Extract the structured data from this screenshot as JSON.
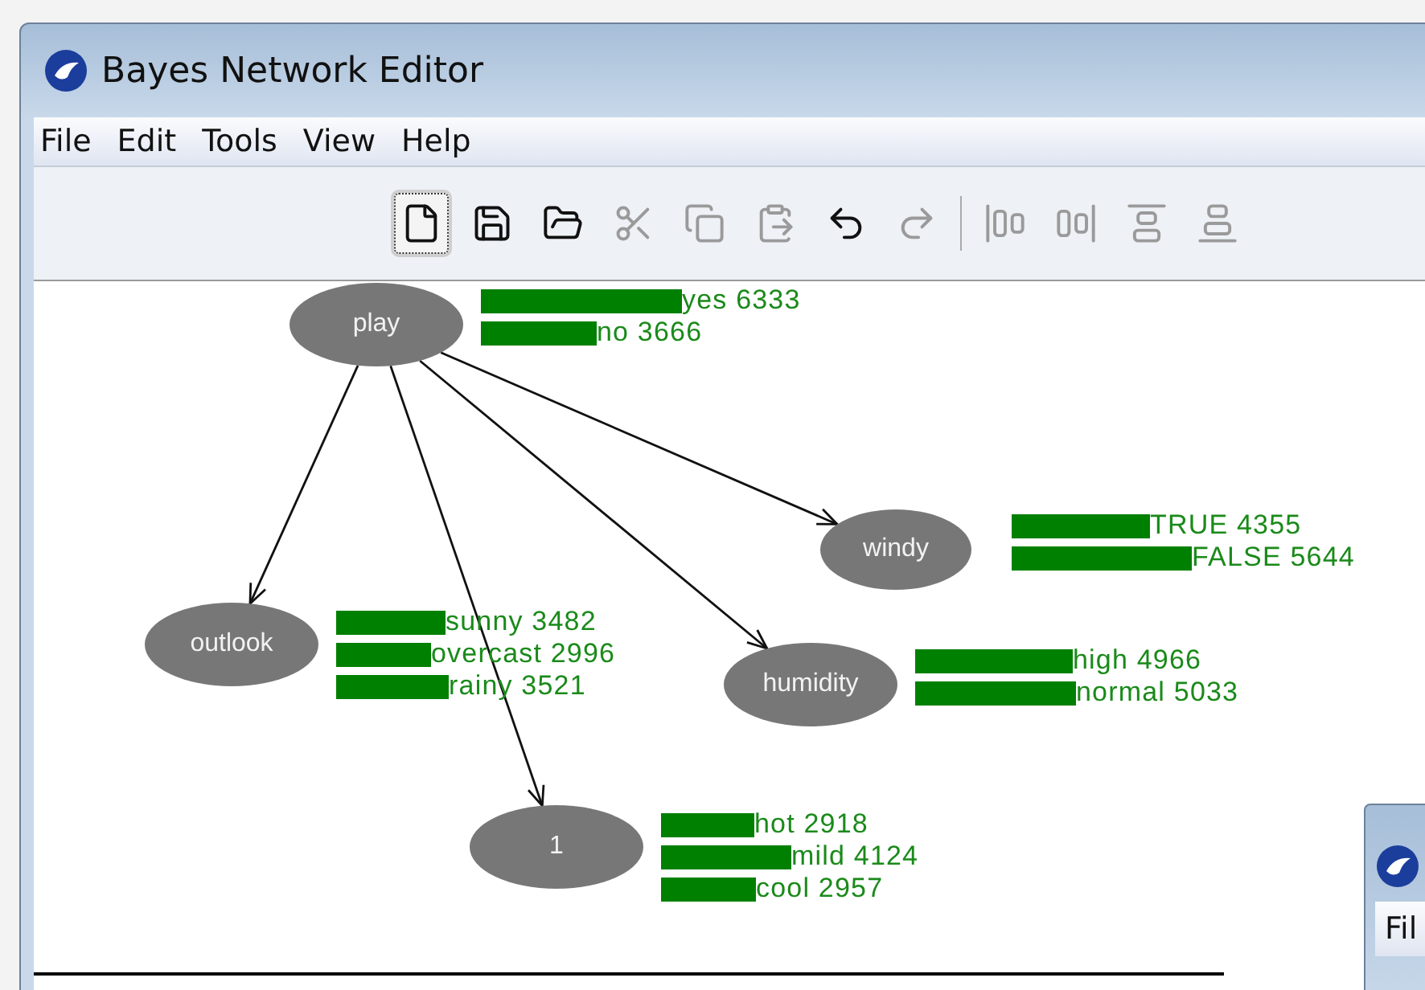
{
  "window": {
    "title": "Bayes Network Editor"
  },
  "menu": [
    "File",
    "Edit",
    "Tools",
    "View",
    "Help"
  ],
  "toolbar": [
    {
      "kind": "new",
      "disabled": false,
      "selected": true
    },
    {
      "kind": "save",
      "disabled": false,
      "selected": false
    },
    {
      "kind": "open",
      "disabled": false,
      "selected": false
    },
    {
      "kind": "cut",
      "disabled": true,
      "selected": false
    },
    {
      "kind": "copy",
      "disabled": true,
      "selected": false
    },
    {
      "kind": "paste",
      "disabled": true,
      "selected": false
    },
    {
      "kind": "undo",
      "disabled": false,
      "selected": false
    },
    {
      "kind": "redo",
      "disabled": true,
      "selected": false
    },
    {
      "kind": "separator"
    },
    {
      "kind": "align-left",
      "disabled": true,
      "selected": false
    },
    {
      "kind": "align-right",
      "disabled": true,
      "selected": false
    },
    {
      "kind": "align-top",
      "disabled": true,
      "selected": false
    },
    {
      "kind": "align-bottom",
      "disabled": true,
      "selected": false
    }
  ],
  "network": {
    "nodes": [
      {
        "name": "play",
        "states": [
          {
            "label": "yes 6333"
          },
          {
            "label": "no 3666"
          }
        ]
      },
      {
        "name": "windy",
        "states": [
          {
            "label": "TRUE 4355"
          },
          {
            "label": "FALSE 5644"
          }
        ]
      },
      {
        "name": "outlook",
        "states": [
          {
            "label": "sunny 3482"
          },
          {
            "label": "overcast 2996"
          },
          {
            "label": "rainy 3521"
          }
        ]
      },
      {
        "name": "humidity",
        "states": [
          {
            "label": "high 4966"
          },
          {
            "label": "normal 5033"
          }
        ]
      },
      {
        "name": "1",
        "states": [
          {
            "label": "hot 2918"
          },
          {
            "label": "mild 4124"
          },
          {
            "label": "cool 2957"
          }
        ]
      }
    ]
  },
  "second_window": {
    "menu": [
      "Fil"
    ]
  }
}
